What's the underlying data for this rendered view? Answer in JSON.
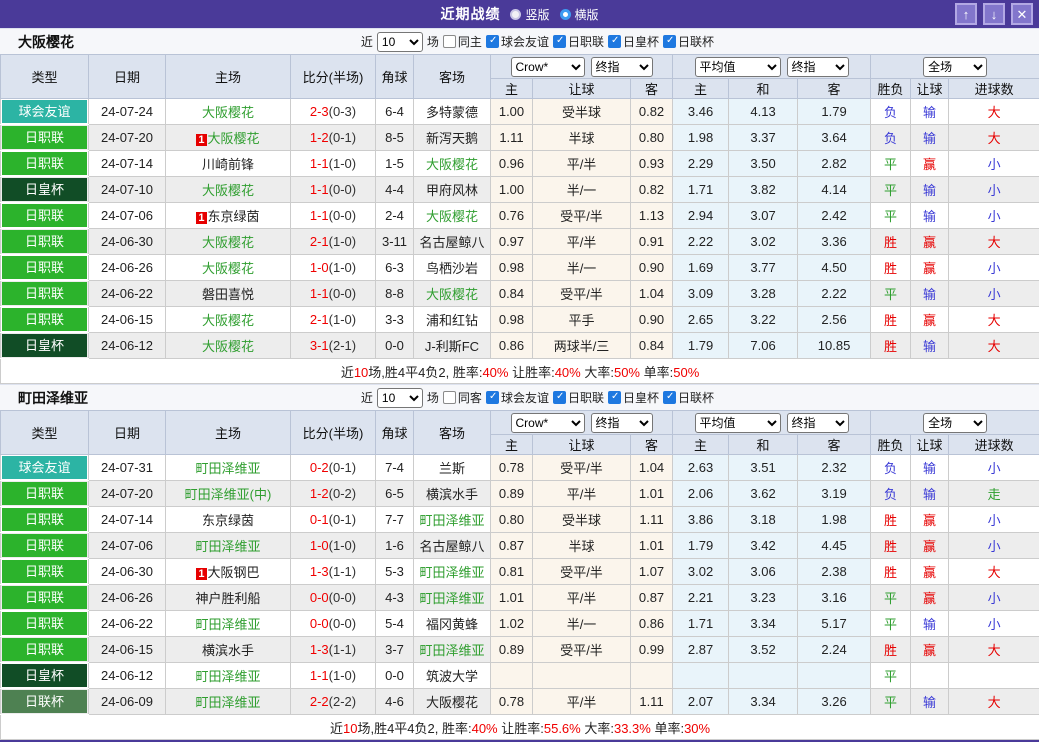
{
  "titlebar": {
    "title": "近期战绩",
    "layout_options": [
      {
        "label": "竖版",
        "selected": true
      },
      {
        "label": "横版",
        "selected": false
      }
    ],
    "up_button": "↑",
    "down_button": "↓",
    "close_button": "✕"
  },
  "colors": {
    "topbar_purple": "#4a3a99",
    "badge_friendly_teal": "#2cb4a4",
    "badge_jleague_green": "#2cb32c",
    "badge_emperor_darkgreen": "#114d26",
    "badge_leaguecup_olive": "#4e8152",
    "team_highlight_green": "#2f9e2f",
    "score_red": "#f00000",
    "result_blue": "#3a3ad6",
    "odds_bg": "#fbf5ec",
    "avg_bg": "#e9f4fa",
    "header_bg": "#dce3ef"
  },
  "filters": {
    "near_label": "近",
    "count_value": "10",
    "games_label": "场",
    "league_options": [
      "球会友谊",
      "日职联",
      "日皇杯",
      "日联杯"
    ]
  },
  "table_header": {
    "cols": [
      "类型",
      "日期",
      "主场",
      "比分(半场)",
      "角球",
      "客场"
    ],
    "odds_company_select": "Crow*",
    "odds_stage_select": "终指",
    "avg_company_select": "平均值",
    "avg_stage_select": "终指",
    "scope_select": "全场",
    "sub_cols": [
      "主",
      "让球",
      "客",
      "主",
      "和",
      "客",
      "胜负",
      "让球",
      "进球数"
    ]
  },
  "sections": [
    {
      "team": "大阪樱花",
      "same_filter_label": "同主",
      "rows": [
        {
          "type": "球会友谊",
          "type_class": "friendly",
          "date": "24-07-24",
          "home": "大阪樱花",
          "home_hl": true,
          "home_mark": "",
          "score": "2-3",
          "half": "(0-3)",
          "corner": "6-4",
          "away": "多特蒙德",
          "away_hl": false,
          "away_mark": "",
          "odds": [
            "1.00",
            "受半球",
            "0.82"
          ],
          "avg": [
            "3.46",
            "4.13",
            "1.79"
          ],
          "result": [
            "负",
            "输",
            "大"
          ],
          "result_cls": [
            "b",
            "b",
            "r"
          ]
        },
        {
          "type": "日职联",
          "type_class": "jleague",
          "date": "24-07-20",
          "home": "大阪樱花",
          "home_hl": true,
          "home_mark": "1",
          "score": "1-2",
          "half": "(0-1)",
          "corner": "8-5",
          "away": "新泻天鹅",
          "away_hl": false,
          "away_mark": "",
          "odds": [
            "1.11",
            "半球",
            "0.80"
          ],
          "avg": [
            "1.98",
            "3.37",
            "3.64"
          ],
          "result": [
            "负",
            "输",
            "大"
          ],
          "result_cls": [
            "b",
            "b",
            "r"
          ]
        },
        {
          "type": "日职联",
          "type_class": "jleague",
          "date": "24-07-14",
          "home": "川崎前锋",
          "home_hl": false,
          "home_mark": "",
          "score": "1-1",
          "half": "(1-0)",
          "corner": "1-5",
          "away": "大阪樱花",
          "away_hl": true,
          "away_mark": "",
          "odds": [
            "0.96",
            "平/半",
            "0.93"
          ],
          "avg": [
            "2.29",
            "3.50",
            "2.82"
          ],
          "result": [
            "平",
            "赢",
            "小"
          ],
          "result_cls": [
            "g",
            "r",
            "b"
          ]
        },
        {
          "type": "日皇杯",
          "type_class": "emperor",
          "date": "24-07-10",
          "home": "大阪樱花",
          "home_hl": true,
          "home_mark": "",
          "score": "1-1",
          "half": "(0-0)",
          "corner": "4-4",
          "away": "甲府风林",
          "away_hl": false,
          "away_mark": "",
          "odds": [
            "1.00",
            "半/一",
            "0.82"
          ],
          "avg": [
            "1.71",
            "3.82",
            "4.14"
          ],
          "result": [
            "平",
            "输",
            "小"
          ],
          "result_cls": [
            "g",
            "b",
            "b"
          ]
        },
        {
          "type": "日职联",
          "type_class": "jleague",
          "date": "24-07-06",
          "home": "东京绿茵",
          "home_hl": false,
          "home_mark": "1",
          "score": "1-1",
          "half": "(0-0)",
          "corner": "2-4",
          "away": "大阪樱花",
          "away_hl": true,
          "away_mark": "",
          "odds": [
            "0.76",
            "受平/半",
            "1.13"
          ],
          "avg": [
            "2.94",
            "3.07",
            "2.42"
          ],
          "result": [
            "平",
            "输",
            "小"
          ],
          "result_cls": [
            "g",
            "b",
            "b"
          ]
        },
        {
          "type": "日职联",
          "type_class": "jleague",
          "date": "24-06-30",
          "home": "大阪樱花",
          "home_hl": true,
          "home_mark": "",
          "score": "2-1",
          "half": "(1-0)",
          "corner": "3-11",
          "away": "名古屋鲸八",
          "away_hl": false,
          "away_mark": "",
          "odds": [
            "0.97",
            "平/半",
            "0.91"
          ],
          "avg": [
            "2.22",
            "3.02",
            "3.36"
          ],
          "result": [
            "胜",
            "赢",
            "大"
          ],
          "result_cls": [
            "r",
            "r",
            "r"
          ]
        },
        {
          "type": "日职联",
          "type_class": "jleague",
          "date": "24-06-26",
          "home": "大阪樱花",
          "home_hl": true,
          "home_mark": "",
          "score": "1-0",
          "half": "(1-0)",
          "corner": "6-3",
          "away": "鸟栖沙岩",
          "away_hl": false,
          "away_mark": "",
          "odds": [
            "0.98",
            "半/一",
            "0.90"
          ],
          "avg": [
            "1.69",
            "3.77",
            "4.50"
          ],
          "result": [
            "胜",
            "赢",
            "小"
          ],
          "result_cls": [
            "r",
            "r",
            "b"
          ]
        },
        {
          "type": "日职联",
          "type_class": "jleague",
          "date": "24-06-22",
          "home": "磐田喜悦",
          "home_hl": false,
          "home_mark": "",
          "score": "1-1",
          "half": "(0-0)",
          "corner": "8-8",
          "away": "大阪樱花",
          "away_hl": true,
          "away_mark": "",
          "odds": [
            "0.84",
            "受平/半",
            "1.04"
          ],
          "avg": [
            "3.09",
            "3.28",
            "2.22"
          ],
          "result": [
            "平",
            "输",
            "小"
          ],
          "result_cls": [
            "g",
            "b",
            "b"
          ]
        },
        {
          "type": "日职联",
          "type_class": "jleague",
          "date": "24-06-15",
          "home": "大阪樱花",
          "home_hl": true,
          "home_mark": "",
          "score": "2-1",
          "half": "(1-0)",
          "corner": "3-3",
          "away": "浦和红钻",
          "away_hl": false,
          "away_mark": "",
          "odds": [
            "0.98",
            "平手",
            "0.90"
          ],
          "avg": [
            "2.65",
            "3.22",
            "2.56"
          ],
          "result": [
            "胜",
            "赢",
            "大"
          ],
          "result_cls": [
            "r",
            "r",
            "r"
          ]
        },
        {
          "type": "日皇杯",
          "type_class": "emperor",
          "date": "24-06-12",
          "home": "大阪樱花",
          "home_hl": true,
          "home_mark": "",
          "score": "3-1",
          "half": "(2-1)",
          "corner": "0-0",
          "away": "J-利斯FC",
          "away_hl": false,
          "away_mark": "",
          "odds": [
            "0.86",
            "两球半/三",
            "0.84"
          ],
          "avg": [
            "1.79",
            "7.06",
            "10.85"
          ],
          "result": [
            "胜",
            "输",
            "大"
          ],
          "result_cls": [
            "r",
            "b",
            "r"
          ]
        }
      ],
      "summary": [
        {
          "text": "近",
          "red": false
        },
        {
          "text": "10",
          "red": true
        },
        {
          "text": "场,胜4平4负2, 胜率:",
          "red": false
        },
        {
          "text": "40%",
          "red": true
        },
        {
          "text": " 让胜率:",
          "red": false
        },
        {
          "text": "40%",
          "red": true
        },
        {
          "text": " 大率:",
          "red": false
        },
        {
          "text": "50%",
          "red": true
        },
        {
          "text": " 单率:",
          "red": false
        },
        {
          "text": "50%",
          "red": true
        }
      ]
    },
    {
      "team": "町田泽维亚",
      "same_filter_label": "同客",
      "rows": [
        {
          "type": "球会友谊",
          "type_class": "friendly",
          "date": "24-07-31",
          "home": "町田泽维亚",
          "home_hl": true,
          "home_mark": "",
          "score": "0-2",
          "half": "(0-1)",
          "corner": "7-4",
          "away": "兰斯",
          "away_hl": false,
          "away_mark": "",
          "odds": [
            "0.78",
            "受平/半",
            "1.04"
          ],
          "avg": [
            "2.63",
            "3.51",
            "2.32"
          ],
          "result": [
            "负",
            "输",
            "小"
          ],
          "result_cls": [
            "b",
            "b",
            "b"
          ]
        },
        {
          "type": "日职联",
          "type_class": "jleague",
          "date": "24-07-20",
          "home": "町田泽维亚(中)",
          "home_hl": true,
          "home_mark": "",
          "score": "1-2",
          "half": "(0-2)",
          "corner": "6-5",
          "away": "横滨水手",
          "away_hl": false,
          "away_mark": "",
          "odds": [
            "0.89",
            "平/半",
            "1.01"
          ],
          "avg": [
            "2.06",
            "3.62",
            "3.19"
          ],
          "result": [
            "负",
            "输",
            "走"
          ],
          "result_cls": [
            "b",
            "b",
            "g"
          ]
        },
        {
          "type": "日职联",
          "type_class": "jleague",
          "date": "24-07-14",
          "home": "东京绿茵",
          "home_hl": false,
          "home_mark": "",
          "score": "0-1",
          "half": "(0-1)",
          "corner": "7-7",
          "away": "町田泽维亚",
          "away_hl": true,
          "away_mark": "",
          "odds": [
            "0.80",
            "受半球",
            "1.11"
          ],
          "avg": [
            "3.86",
            "3.18",
            "1.98"
          ],
          "result": [
            "胜",
            "赢",
            "小"
          ],
          "result_cls": [
            "r",
            "r",
            "b"
          ]
        },
        {
          "type": "日职联",
          "type_class": "jleague",
          "date": "24-07-06",
          "home": "町田泽维亚",
          "home_hl": true,
          "home_mark": "",
          "score": "1-0",
          "half": "(1-0)",
          "corner": "1-6",
          "away": "名古屋鲸八",
          "away_hl": false,
          "away_mark": "",
          "odds": [
            "0.87",
            "半球",
            "1.01"
          ],
          "avg": [
            "1.79",
            "3.42",
            "4.45"
          ],
          "result": [
            "胜",
            "赢",
            "小"
          ],
          "result_cls": [
            "r",
            "r",
            "b"
          ]
        },
        {
          "type": "日职联",
          "type_class": "jleague",
          "date": "24-06-30",
          "home": "大阪钢巴",
          "home_hl": false,
          "home_mark": "1",
          "score": "1-3",
          "half": "(1-1)",
          "corner": "5-3",
          "away": "町田泽维亚",
          "away_hl": true,
          "away_mark": "",
          "odds": [
            "0.81",
            "受平/半",
            "1.07"
          ],
          "avg": [
            "3.02",
            "3.06",
            "2.38"
          ],
          "result": [
            "胜",
            "赢",
            "大"
          ],
          "result_cls": [
            "r",
            "r",
            "r"
          ]
        },
        {
          "type": "日职联",
          "type_class": "jleague",
          "date": "24-06-26",
          "home": "神户胜利船",
          "home_hl": false,
          "home_mark": "",
          "score": "0-0",
          "half": "(0-0)",
          "corner": "4-3",
          "away": "町田泽维亚",
          "away_hl": true,
          "away_mark": "",
          "odds": [
            "1.01",
            "平/半",
            "0.87"
          ],
          "avg": [
            "2.21",
            "3.23",
            "3.16"
          ],
          "result": [
            "平",
            "赢",
            "小"
          ],
          "result_cls": [
            "g",
            "r",
            "b"
          ]
        },
        {
          "type": "日职联",
          "type_class": "jleague",
          "date": "24-06-22",
          "home": "町田泽维亚",
          "home_hl": true,
          "home_mark": "",
          "score": "0-0",
          "half": "(0-0)",
          "corner": "5-4",
          "away": "福冈黄蜂",
          "away_hl": false,
          "away_mark": "",
          "odds": [
            "1.02",
            "半/一",
            "0.86"
          ],
          "avg": [
            "1.71",
            "3.34",
            "5.17"
          ],
          "result": [
            "平",
            "输",
            "小"
          ],
          "result_cls": [
            "g",
            "b",
            "b"
          ]
        },
        {
          "type": "日职联",
          "type_class": "jleague",
          "date": "24-06-15",
          "home": "横滨水手",
          "home_hl": false,
          "home_mark": "",
          "score": "1-3",
          "half": "(1-1)",
          "corner": "3-7",
          "away": "町田泽维亚",
          "away_hl": true,
          "away_mark": "",
          "odds": [
            "0.89",
            "受平/半",
            "0.99"
          ],
          "avg": [
            "2.87",
            "3.52",
            "2.24"
          ],
          "result": [
            "胜",
            "赢",
            "大"
          ],
          "result_cls": [
            "r",
            "r",
            "r"
          ]
        },
        {
          "type": "日皇杯",
          "type_class": "emperor",
          "date": "24-06-12",
          "home": "町田泽维亚",
          "home_hl": true,
          "home_mark": "",
          "score": "1-1",
          "half": "(1-0)",
          "corner": "0-0",
          "away": "筑波大学",
          "away_hl": false,
          "away_mark": "",
          "odds": [
            "",
            "",
            ""
          ],
          "avg": [
            "",
            "",
            ""
          ],
          "result": [
            "平",
            "",
            ""
          ],
          "result_cls": [
            "g",
            "",
            ""
          ]
        },
        {
          "type": "日联杯",
          "type_class": "leaguecup",
          "date": "24-06-09",
          "home": "町田泽维亚",
          "home_hl": true,
          "home_mark": "",
          "score": "2-2",
          "half": "(2-2)",
          "corner": "4-6",
          "away": "大阪樱花",
          "away_hl": false,
          "away_mark": "",
          "odds": [
            "0.78",
            "平/半",
            "1.11"
          ],
          "avg": [
            "2.07",
            "3.34",
            "3.26"
          ],
          "result": [
            "平",
            "输",
            "大"
          ],
          "result_cls": [
            "g",
            "b",
            "r"
          ]
        }
      ],
      "summary": [
        {
          "text": "近",
          "red": false
        },
        {
          "text": "10",
          "red": true
        },
        {
          "text": "场,胜4平4负2, 胜率:",
          "red": false
        },
        {
          "text": "40%",
          "red": true
        },
        {
          "text": " 让胜率:",
          "red": false
        },
        {
          "text": "55.6%",
          "red": true
        },
        {
          "text": " 大率:",
          "red": false
        },
        {
          "text": "33.3%",
          "red": true
        },
        {
          "text": " 单率:",
          "red": false
        },
        {
          "text": "30%",
          "red": true
        }
      ]
    }
  ]
}
